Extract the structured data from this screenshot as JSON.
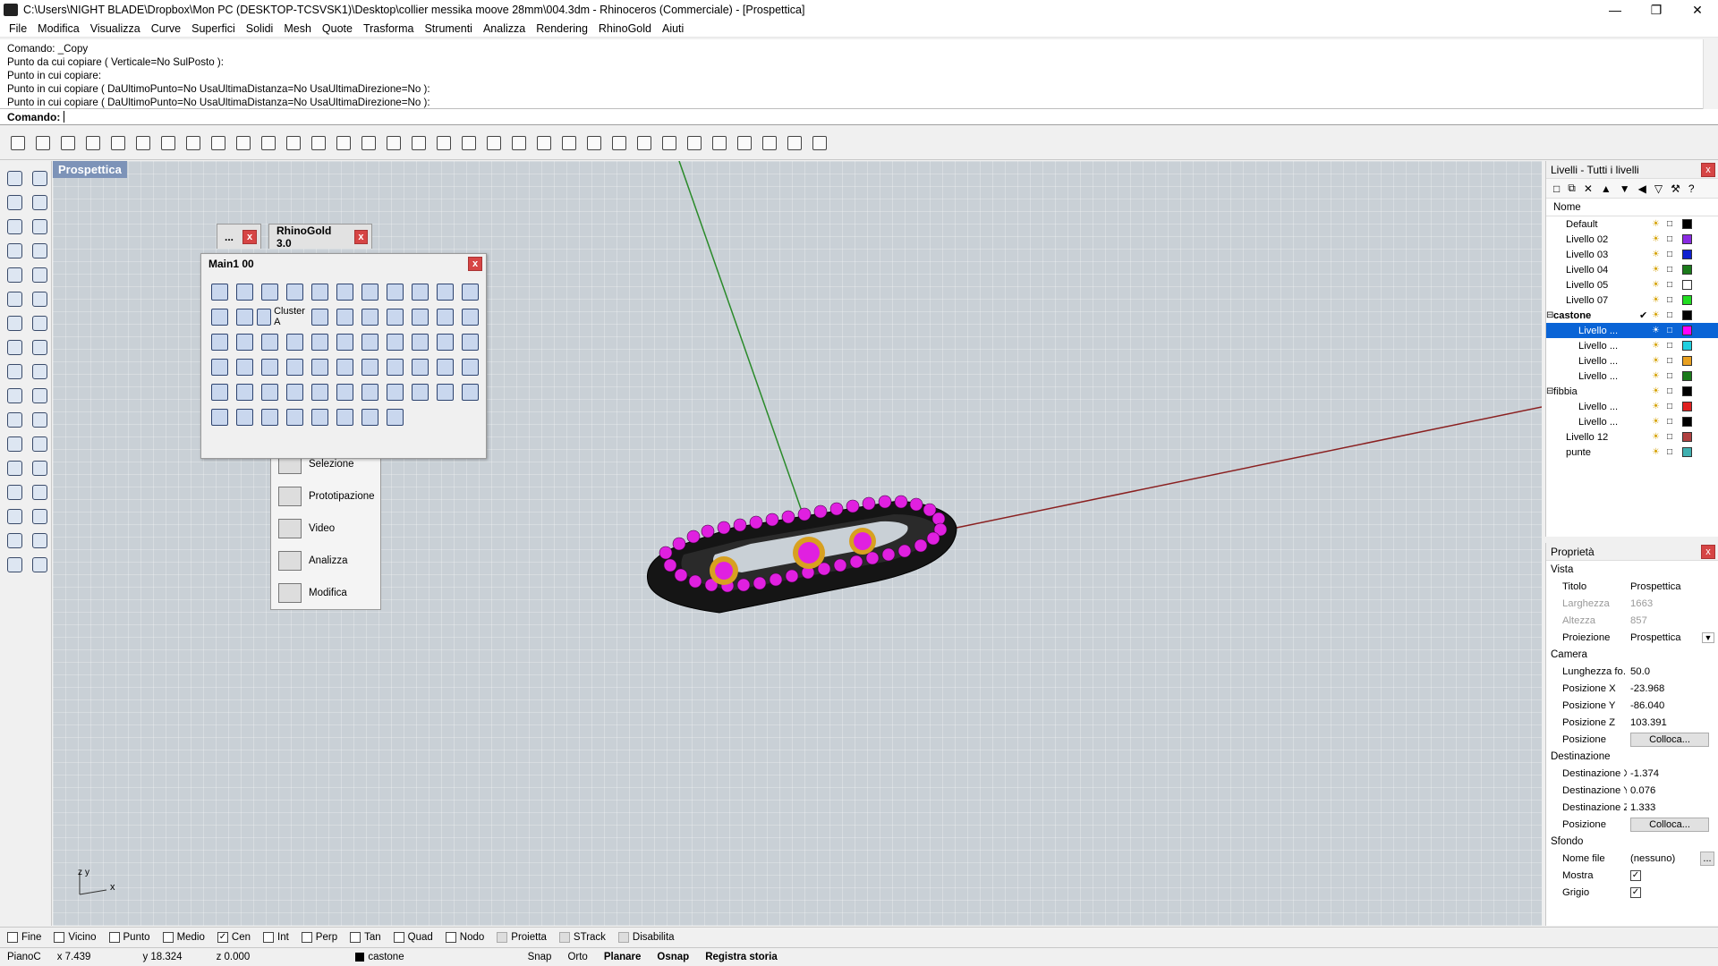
{
  "window": {
    "title": "C:\\Users\\NIGHT BLADE\\Dropbox\\Mon PC (DESKTOP-TCSVSK1)\\Desktop\\collier messika moove 28mm\\004.3dm - Rhinoceros (Commerciale) - [Prospettica]",
    "controls": [
      "—",
      "❐",
      "✕"
    ]
  },
  "menu": [
    "File",
    "Modifica",
    "Visualizza",
    "Curve",
    "Superfici",
    "Solidi",
    "Mesh",
    "Quote",
    "Trasforma",
    "Strumenti",
    "Analizza",
    "Rendering",
    "RhinoGold",
    "Aiuti"
  ],
  "command_history": [
    "Comando: _Copy",
    "Punto da cui copiare ( Verticale=No  SulPosto ):",
    "Punto in cui copiare:",
    "Punto in cui copiare ( DaUltimoPunto=No  UsaUltimaDistanza=No  UsaUltimaDirezione=No ):",
    "Punto in cui copiare ( DaUltimoPunto=No  UsaUltimaDistanza=No  UsaUltimaDirezione=No ):"
  ],
  "command_prompt": "Comando:",
  "viewport": {
    "label": "Prospettica"
  },
  "rhinogold": {
    "tab_small": "...",
    "tab_main": "RhinoGold 3.0",
    "main_title": "Main1 00",
    "cluster_label": "Cluster A",
    "panel_items": [
      "Selezione",
      "Prototipazione",
      "Video",
      "Analizza",
      "Modifica"
    ]
  },
  "layers": {
    "title": "Livelli - Tutti i livelli",
    "column": "Nome",
    "rows": [
      {
        "name": "Default",
        "color": "#000000",
        "indent": 1
      },
      {
        "name": "Livello 02",
        "color": "#8a2be2",
        "indent": 1
      },
      {
        "name": "Livello 03",
        "color": "#1020d0",
        "indent": 1
      },
      {
        "name": "Livello 04",
        "color": "#1a7a1a",
        "indent": 1
      },
      {
        "name": "Livello 05",
        "color": "#ffffff",
        "indent": 1
      },
      {
        "name": "Livello 07",
        "color": "#22dd22",
        "indent": 1
      },
      {
        "name": "castone",
        "color": "#000000",
        "indent": 0,
        "expander": "⊟",
        "bold": true,
        "check": "✔"
      },
      {
        "name": "Livello ...",
        "color": "#ff00ff",
        "indent": 2,
        "selected": true
      },
      {
        "name": "Livello ...",
        "color": "#20d0e0",
        "indent": 2
      },
      {
        "name": "Livello ...",
        "color": "#e8a020",
        "indent": 2
      },
      {
        "name": "Livello ...",
        "color": "#1a7a1a",
        "indent": 2
      },
      {
        "name": "fibbia",
        "color": "#000000",
        "indent": 0,
        "expander": "⊟"
      },
      {
        "name": "Livello ...",
        "color": "#e02020",
        "indent": 2
      },
      {
        "name": "Livello ...",
        "color": "#000000",
        "indent": 2
      },
      {
        "name": "Livello 12",
        "color": "#b04040",
        "indent": 1
      },
      {
        "name": "punte",
        "color": "#40b0b0",
        "indent": 1
      }
    ]
  },
  "properties": {
    "title": "Proprietà",
    "section_vista": "Vista",
    "titolo": {
      "k": "Titolo",
      "v": "Prospettica"
    },
    "larghezza": {
      "k": "Larghezza",
      "v": "1663"
    },
    "altezza": {
      "k": "Altezza",
      "v": "857"
    },
    "proiezione": {
      "k": "Proiezione",
      "v": "Prospettica"
    },
    "section_camera": "Camera",
    "lunghezza": {
      "k": "Lunghezza fo...",
      "v": "50.0"
    },
    "posx": {
      "k": "Posizione X",
      "v": "-23.968"
    },
    "posy": {
      "k": "Posizione Y",
      "v": "-86.040"
    },
    "posz": {
      "k": "Posizione Z",
      "v": "103.391"
    },
    "posizione": {
      "k": "Posizione",
      "btn": "Colloca..."
    },
    "section_dest": "Destinazione",
    "destx": {
      "k": "Destinazione X",
      "v": "-1.374"
    },
    "desty": {
      "k": "Destinazione Y",
      "v": "0.076"
    },
    "destz": {
      "k": "Destinazione Z",
      "v": "1.333"
    },
    "posizione2": {
      "k": "Posizione",
      "btn": "Colloca..."
    },
    "section_sfondo": "Sfondo",
    "nomefile": {
      "k": "Nome file",
      "v": "(nessuno)",
      "btn": "..."
    },
    "mostra": {
      "k": "Mostra"
    },
    "grigio": {
      "k": "Grigio"
    }
  },
  "osnap": [
    {
      "label": "Fine",
      "checked": false
    },
    {
      "label": "Vicino",
      "checked": false
    },
    {
      "label": "Punto",
      "checked": false
    },
    {
      "label": "Medio",
      "checked": false
    },
    {
      "label": "Cen",
      "checked": true
    },
    {
      "label": "Int",
      "checked": false
    },
    {
      "label": "Perp",
      "checked": false
    },
    {
      "label": "Tan",
      "checked": false
    },
    {
      "label": "Quad",
      "checked": false
    },
    {
      "label": "Nodo",
      "checked": false
    },
    {
      "label": "Proietta",
      "checked": false,
      "grey": true
    },
    {
      "label": "STrack",
      "checked": false,
      "grey": true
    },
    {
      "label": "Disabilita",
      "checked": false,
      "grey": true
    }
  ],
  "status": {
    "plane": "PianoC",
    "x": "x 7.439",
    "y": "y 18.324",
    "z": "z 0.000",
    "layer": "castone",
    "snap": "Snap",
    "orto": "Orto",
    "planare": "Planare",
    "osnap": "Osnap",
    "history": "Registra storia"
  },
  "axis_labels": {
    "z": "z",
    "y": "y",
    "x": "x"
  },
  "colors": {
    "viewport_bg": "#c9d0d6",
    "accent_magenta": "#e020e0",
    "selection": "#0a64d6"
  }
}
